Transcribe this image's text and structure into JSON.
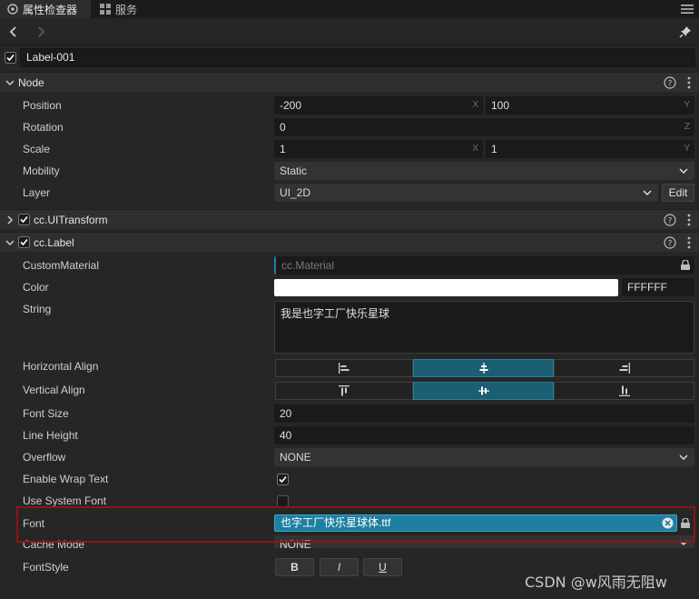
{
  "tabs": [
    {
      "label": "属性检查器",
      "icon": "inspector-icon"
    },
    {
      "label": "服务",
      "icon": "services-icon"
    }
  ],
  "node": {
    "name": "Label-001",
    "enabled": true
  },
  "sections": {
    "node": {
      "title": "Node",
      "position": {
        "label": "Position",
        "x": "-200",
        "y": "100",
        "x_axis": "X",
        "y_axis": "Y"
      },
      "rotation": {
        "label": "Rotation",
        "value": "0",
        "axis": "Z"
      },
      "scale": {
        "label": "Scale",
        "x": "1",
        "y": "1",
        "x_axis": "X",
        "y_axis": "Y"
      },
      "mobility": {
        "label": "Mobility",
        "value": "Static"
      },
      "layer": {
        "label": "Layer",
        "value": "UI_2D",
        "edit_label": "Edit"
      }
    },
    "uitransform": {
      "title": "cc.UITransform",
      "enabled": true
    },
    "label": {
      "title": "cc.Label",
      "enabled": true,
      "custom_material": {
        "label": "CustomMaterial",
        "placeholder": "cc.Material"
      },
      "color": {
        "label": "Color",
        "hex": "FFFFFF",
        "swatch": "#ffffff"
      },
      "string": {
        "label": "String",
        "value": "我是也字工厂快乐星球"
      },
      "horizontal_align": {
        "label": "Horizontal Align",
        "selected_index": 1,
        "options": [
          "align-left-icon",
          "align-center-icon",
          "align-right-icon"
        ]
      },
      "vertical_align": {
        "label": "Vertical Align",
        "selected_index": 1,
        "options": [
          "align-top-icon",
          "align-middle-icon",
          "align-bottom-icon"
        ]
      },
      "font_size": {
        "label": "Font Size",
        "value": "20"
      },
      "line_height": {
        "label": "Line Height",
        "value": "40"
      },
      "overflow": {
        "label": "Overflow",
        "value": "NONE"
      },
      "wrap_text": {
        "label": "Enable Wrap Text",
        "checked": true
      },
      "system_font": {
        "label": "Use System Font",
        "checked": false
      },
      "font": {
        "label": "Font",
        "value": "也字工厂快乐星球体.ttf"
      },
      "cache_mode": {
        "label": "Cache Mode",
        "value": "NONE"
      },
      "font_style": {
        "label": "FontStyle",
        "bold": "B",
        "italic": "I",
        "underline": "U"
      }
    }
  },
  "watermark": "CSDN @w风雨无阻w",
  "colors": {
    "accent": "#1a5f73",
    "highlight": "#8b1515",
    "font_asset": "#1f7fa0"
  }
}
